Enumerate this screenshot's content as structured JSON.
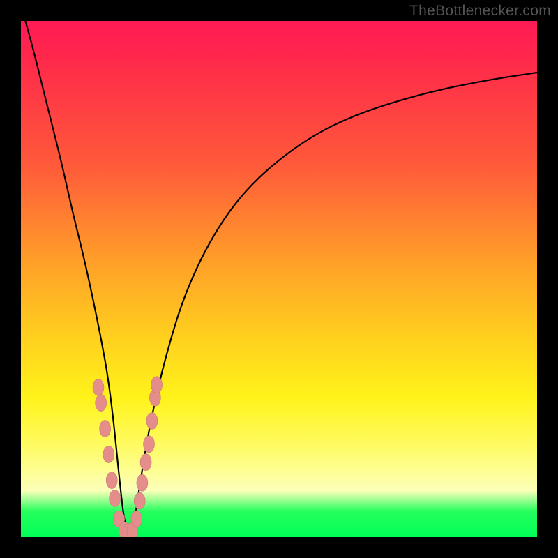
{
  "watermark": {
    "text": "TheBottlenecker.com"
  },
  "colors": {
    "frame": "#000000",
    "curve": "#000000",
    "markers_fill": "#e58d8a",
    "markers_stroke": "#c97a78",
    "gradient_top": "#ff1a55",
    "gradient_bottom": "#00ff57"
  },
  "chart_data": {
    "type": "line",
    "title": "",
    "xlabel": "",
    "ylabel": "",
    "xlim": [
      0,
      100
    ],
    "ylim": [
      0,
      100
    ],
    "grid": false,
    "legend": false,
    "series": [
      {
        "name": "bottleneck-curve",
        "x": [
          0,
          2,
          4,
          6,
          8,
          10,
          12,
          14,
          16,
          17,
          18,
          19,
          20,
          21,
          22,
          23,
          25,
          28,
          32,
          38,
          45,
          55,
          65,
          78,
          90,
          100
        ],
        "y": [
          103,
          96,
          88,
          80,
          72,
          63,
          55,
          46,
          36,
          30,
          22,
          12,
          3,
          0.5,
          3,
          10,
          22,
          35,
          48,
          60,
          69,
          77,
          82,
          86,
          88.5,
          90
        ]
      }
    ],
    "markers": [
      {
        "x": 15.0,
        "y": 29
      },
      {
        "x": 15.5,
        "y": 26
      },
      {
        "x": 16.3,
        "y": 21
      },
      {
        "x": 17.0,
        "y": 16
      },
      {
        "x": 17.6,
        "y": 11
      },
      {
        "x": 18.2,
        "y": 7.5
      },
      {
        "x": 19.0,
        "y": 3.5
      },
      {
        "x": 20.0,
        "y": 1.3
      },
      {
        "x": 20.8,
        "y": 1.0
      },
      {
        "x": 21.6,
        "y": 1.2
      },
      {
        "x": 22.4,
        "y": 3.5
      },
      {
        "x": 23.0,
        "y": 7.0
      },
      {
        "x": 23.5,
        "y": 10.5
      },
      {
        "x": 24.2,
        "y": 14.5
      },
      {
        "x": 24.8,
        "y": 18.0
      },
      {
        "x": 25.4,
        "y": 22.5
      },
      {
        "x": 26.0,
        "y": 27.0
      },
      {
        "x": 26.3,
        "y": 29.5
      }
    ]
  }
}
